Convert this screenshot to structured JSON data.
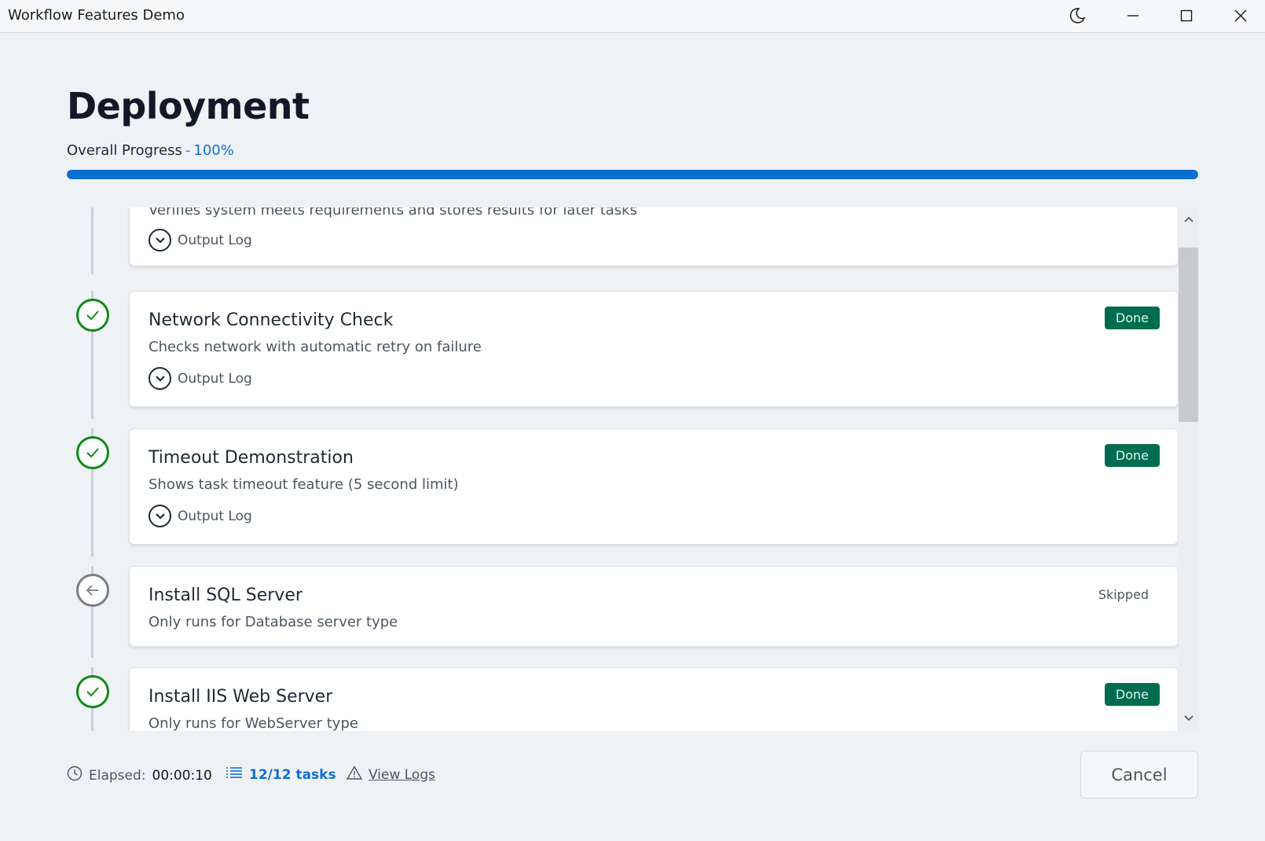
{
  "window": {
    "title": "Workflow Features Demo",
    "controls": [
      "moon-icon",
      "minimize-icon",
      "maximize-icon",
      "close-icon"
    ]
  },
  "header": {
    "title": "Deployment",
    "progress_label": "Overall Progress",
    "progress_separator": "-",
    "progress_value": "100%",
    "progress_fraction": 1.0
  },
  "tasks": [
    {
      "title": "",
      "description": "Verifies system meets requirements and stores results for later tasks",
      "status": "",
      "log_label": "Output Log"
    },
    {
      "title": "Network Connectivity Check",
      "description": "Checks network with automatic retry on failure",
      "status": "Done",
      "log_label": "Output Log"
    },
    {
      "title": "Timeout Demonstration",
      "description": "Shows task timeout feature (5 second limit)",
      "status": "Done",
      "log_label": "Output Log"
    },
    {
      "title": "Install SQL Server",
      "description": "Only runs for Database server type",
      "status": "Skipped"
    },
    {
      "title": "Install IIS Web Server",
      "description": "Only runs for WebServer type",
      "status": "Done"
    }
  ],
  "footer": {
    "elapsed_label": "Elapsed:",
    "elapsed_value": "00:00:10",
    "tasks_count": "12/12 tasks",
    "view_logs": "View Logs",
    "cancel": "Cancel"
  },
  "colors": {
    "accent": "#0b6fd1",
    "done_badge": "#006c4f",
    "done_icon": "#118a1b",
    "skipped_icon": "#7b7f86"
  }
}
